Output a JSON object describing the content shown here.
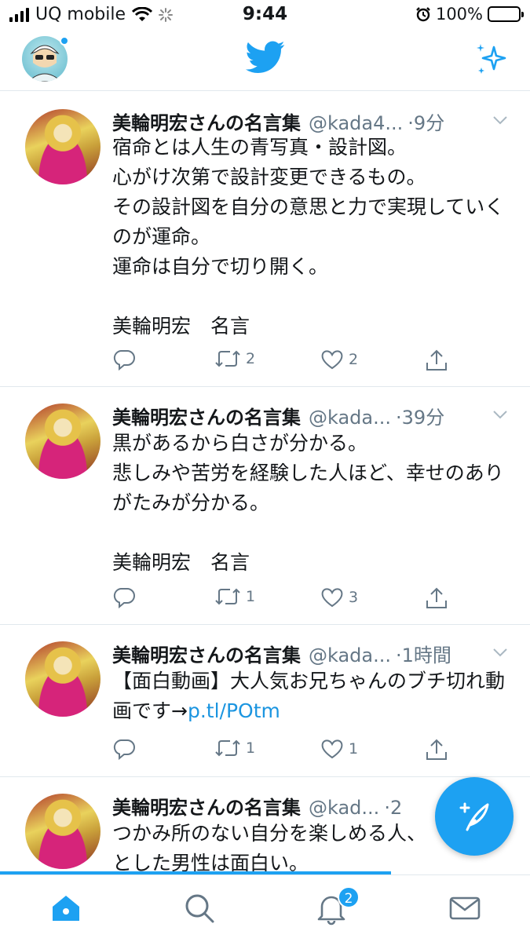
{
  "status_bar": {
    "carrier": "UQ mobile",
    "time": "9:44",
    "battery": "100%"
  },
  "header": {
    "profile_icon": "avatar-icon",
    "logo_icon": "twitter-bird-icon",
    "sparkle_icon": "sparkle-icon"
  },
  "tweets": [
    {
      "name": "美輪明宏さんの名言集",
      "handle": "@kada4...",
      "time": "9分",
      "text": "宿命とは人生の青写真・設計図。\n心がけ次第で設計変更できるもの。\nその設計図を自分の意思と力で実現していくのが運命。\n運命は自分で切り開く。\n\n美輪明宏　名言",
      "retweets": "2",
      "likes": "2"
    },
    {
      "name": "美輪明宏さんの名言集",
      "handle": "@kada...",
      "time": "39分",
      "text": "黒があるから白さが分かる。\n悲しみや苦労を経験した人ほど、幸せのありがたみが分かる。\n\n美輪明宏　名言",
      "retweets": "1",
      "likes": "3"
    },
    {
      "name": "美輪明宏さんの名言集",
      "handle": "@kada...",
      "time": "1時間",
      "text": "【面白動画】大人気お兄ちゃんのブチ切れ動画です→",
      "link": "p.tl/POtm",
      "retweets": "1",
      "likes": "1"
    },
    {
      "name": "美輪明宏さんの名言集",
      "handle": "@kad...",
      "time": "2",
      "text": "つかみ所のない自分を楽しめる人、\nとした男性は面白い。"
    }
  ],
  "tabbar": {
    "notification_badge": "2"
  },
  "colors": {
    "accent": "#1da1f2",
    "muted": "#657786",
    "link": "#1b95e0"
  }
}
